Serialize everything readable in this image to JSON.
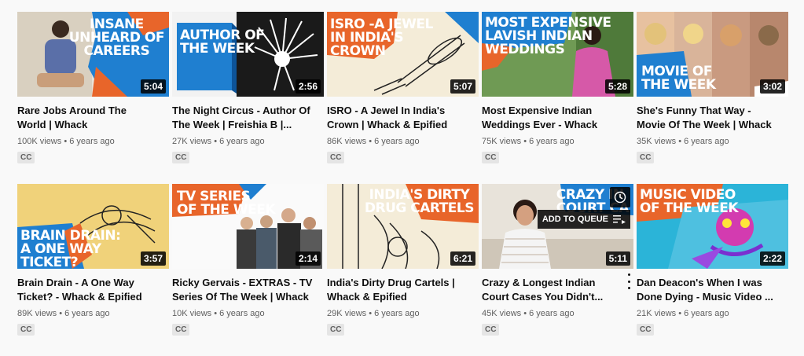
{
  "videos": [
    {
      "overlay": "INSANE\nUNHEARD OF\nCAREERS",
      "duration": "5:04",
      "title": "Rare Jobs Around The World | Whack",
      "views": "100K views",
      "age": "6 years ago",
      "badge": "CC"
    },
    {
      "overlay": "AUTHOR OF\nTHE WEEK",
      "duration": "2:56",
      "title": "The Night Circus - Author Of The Week | Freishia B |...",
      "views": "27K views",
      "age": "6 years ago",
      "badge": "CC"
    },
    {
      "overlay": "ISRO -A JEWEL\nIN INDIA'S\nCROWN",
      "duration": "5:07",
      "title": "ISRO - A Jewel In India's Crown | Whack & Epified",
      "views": "86K views",
      "age": "6 years ago",
      "badge": "CC"
    },
    {
      "overlay": "MOST EXPENSIVE\nLAVISH INDIAN\nWEDDINGS",
      "duration": "5:28",
      "title": "Most Expensive Indian Weddings Ever - Whack",
      "views": "75K views",
      "age": "6 years ago",
      "badge": "CC"
    },
    {
      "overlay": "MOVIE OF\nTHE WEEK",
      "duration": "3:02",
      "title": "She's Funny That Way - Movie Of The Week | Whack",
      "views": "35K views",
      "age": "6 years ago",
      "badge": "CC"
    },
    {
      "overlay": "BRAIN DRAIN:\nA ONE WAY\nTICKET?",
      "duration": "3:57",
      "title": "Brain Drain - A One Way Ticket? - Whack & Epified",
      "views": "89K views",
      "age": "6 years ago",
      "badge": "CC"
    },
    {
      "overlay": "TV SERIES\nOF THE WEEK",
      "duration": "2:14",
      "title": "Ricky Gervais - EXTRAS - TV Series Of The Week | Whack",
      "views": "10K views",
      "age": "6 years ago",
      "badge": "CC"
    },
    {
      "overlay": "INDIA'S DIRTY\nDRUG CARTELS",
      "duration": "6:21",
      "title": "India's Dirty Drug Cartels | Whack & Epified",
      "views": "29K views",
      "age": "6 years ago",
      "badge": "CC"
    },
    {
      "overlay": "CRAZY IN\nCOURT CA",
      "duration": "5:11",
      "title": "Crazy & Longest Indian Court Cases You Didn't...",
      "views": "45K views",
      "age": "6 years ago",
      "badge": "CC",
      "queue_label": "ADD TO QUEUE"
    },
    {
      "overlay": "MUSIC VIDEO\nOF THE WEEK",
      "duration": "2:22",
      "title": "Dan Deacon's When I was Done Dying - Music Video ...",
      "views": "21K views",
      "age": "6 years ago",
      "badge": "CC"
    }
  ],
  "meta_separator": "•",
  "colors": {
    "accent_blue": "#1f7fd0",
    "accent_orange": "#e8652a",
    "duration_bg": "#000000",
    "cc_bg": "#e5e5e5"
  },
  "icons": {
    "clock": "watch-later-icon",
    "queue": "add-to-queue-icon",
    "menu": "more-vert-icon"
  }
}
